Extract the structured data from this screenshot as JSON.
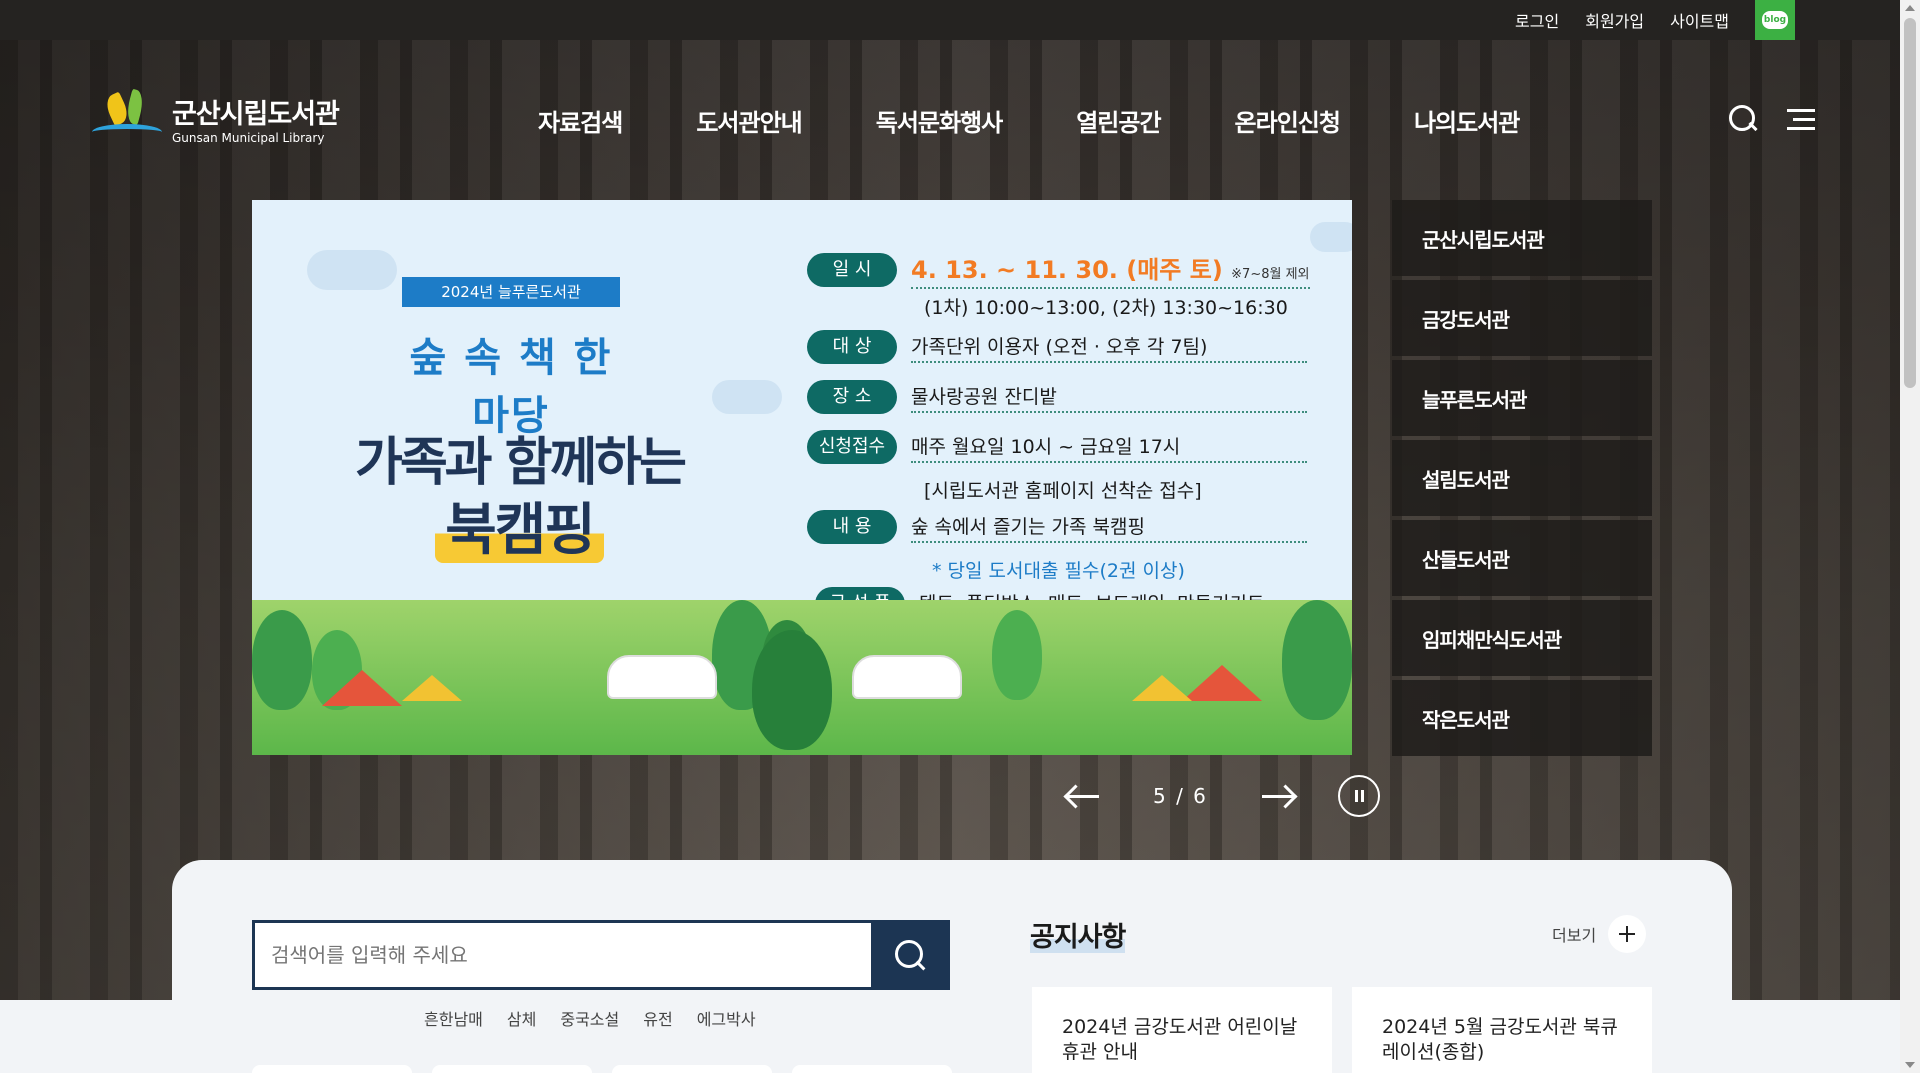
{
  "top_links": {
    "login": "로그인",
    "signup": "회원가입",
    "sitemap": "사이트맵",
    "blog": "blog"
  },
  "logo": {
    "name_ko": "군산시립도서관",
    "name_en": "Gunsan Municipal Library"
  },
  "nav": {
    "items": [
      {
        "label": "자료검색"
      },
      {
        "label": "도서관안내"
      },
      {
        "label": "독서문화행사"
      },
      {
        "label": "열린공간"
      },
      {
        "label": "온라인신청"
      },
      {
        "label": "나의도서관"
      }
    ]
  },
  "utility_icons": [
    "search-icon",
    "menu-icon"
  ],
  "banner": {
    "tag": "2024년 늘푸른도서관",
    "subtitle": "숲 속 책 한마당",
    "title_line1": "가족과 함께하는",
    "title_line2": "북캠핑",
    "rows": [
      {
        "label": "일  시",
        "value": "4. 13. ~ 11. 30. (매주 토)",
        "note": "※7~8월 제외",
        "extra": "(1차) 10:00~13:00,   (2차) 13:30~16:30"
      },
      {
        "label": "대  상",
        "value": "가족단위 이용자 (오전 · 오후 각 7팀)"
      },
      {
        "label": "장  소",
        "value": "물사랑공원 잔디밭"
      },
      {
        "label": "신청접수",
        "value": "매주 월요일 10시 ~ 금요일 17시",
        "extra": "[시립도서관 홈페이지 선착순 접수]"
      },
      {
        "label": "내  용",
        "value": "숲 속에서 즐기는 가족 북캠핑",
        "extra": "* 당일 도서대출 필수(2권 이상)"
      },
      {
        "label": "구 성 품",
        "value": "텐트, 폴딩박스, 매트, 보드게임, 만들기키트"
      }
    ],
    "colors": {
      "accent": "#1d7cc7",
      "pill": "#0e6a64",
      "date": "#f27b23",
      "title": "#1f3557"
    }
  },
  "side_tabs": [
    {
      "label": "군산시립도서관"
    },
    {
      "label": "금강도서관"
    },
    {
      "label": "늘푸른도서관"
    },
    {
      "label": "설림도서관"
    },
    {
      "label": "산들도서관"
    },
    {
      "label": "임피채만식도서관"
    },
    {
      "label": "작은도서관"
    }
  ],
  "slider": {
    "counter": "5 / 6"
  },
  "search": {
    "placeholder": "검색어를 입력해 주세요"
  },
  "keywords": [
    "흔한남매",
    "삼체",
    "중국소설",
    "유전",
    "에그박사"
  ],
  "notice": {
    "title": "공지사항",
    "more_label": "더보기",
    "items": [
      {
        "title": "2024년 금강도서관 어린이날 휴관 안내"
      },
      {
        "title": "2024년 5월 금강도서관 북큐레이션(종합)"
      }
    ]
  }
}
